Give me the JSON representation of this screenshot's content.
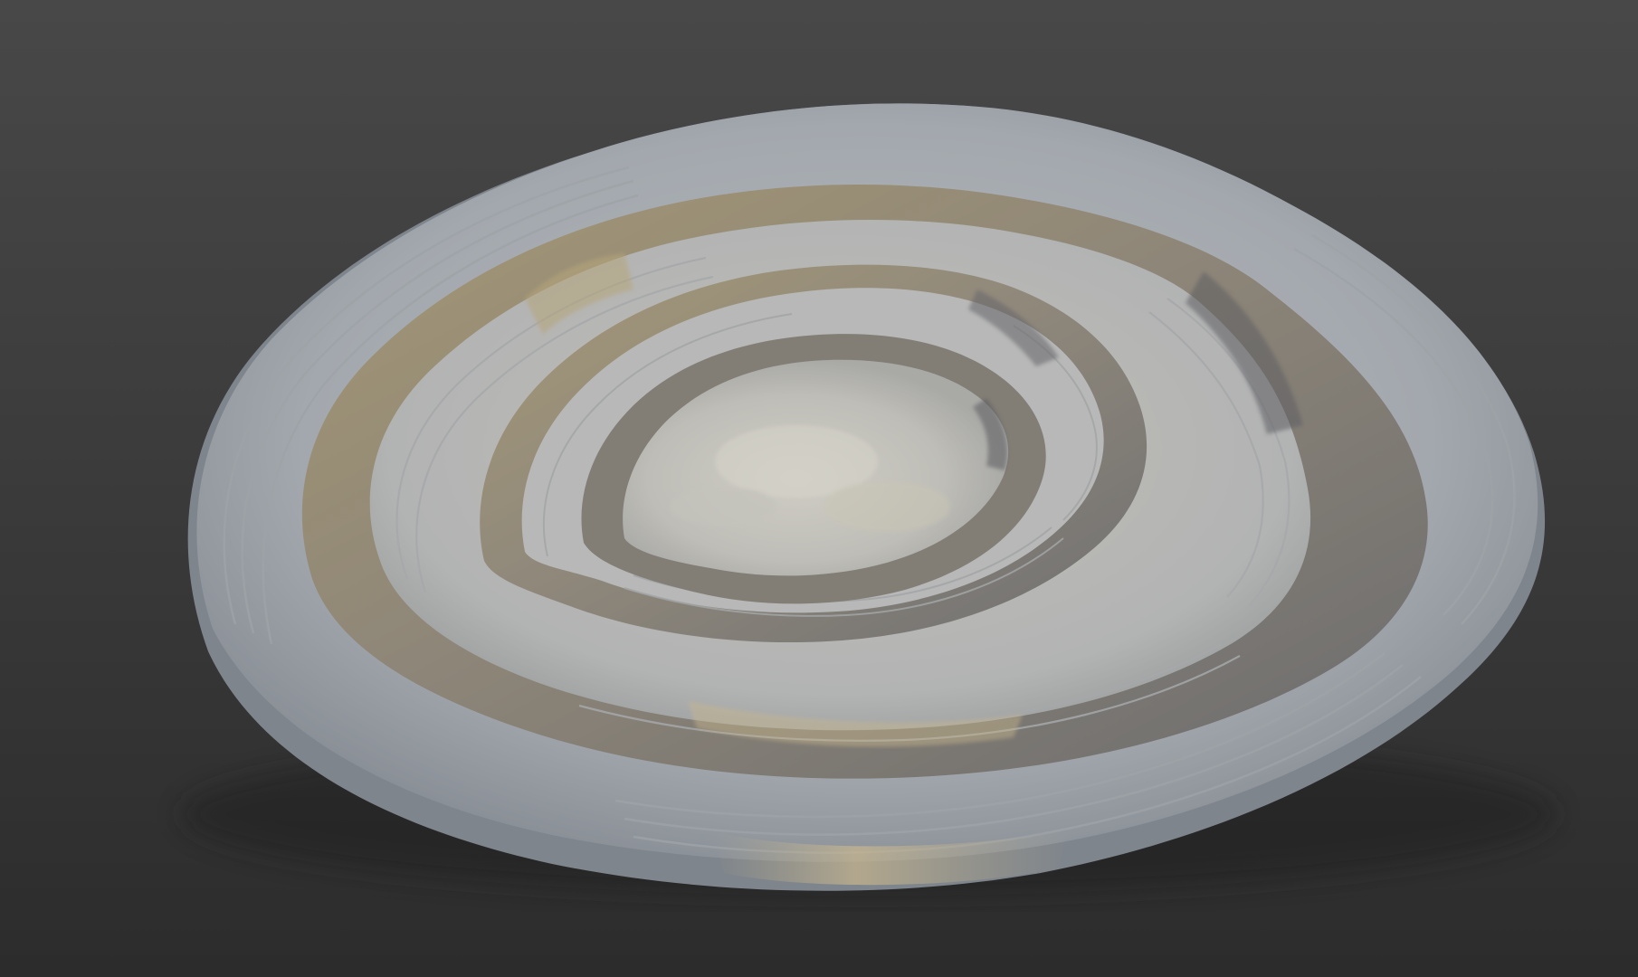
{
  "viewport": {
    "background_top": "#484848",
    "background_bottom": "#2c2c2c"
  },
  "model": {
    "subject": "open-pit-mine-terrain",
    "colors": {
      "rim": "#a9adb2",
      "rim_shadow": "#7d838a",
      "bench": "#b9bcc0",
      "wall_warm": "#a89c82",
      "wall_dark": "#6f6d6a",
      "floor": "#c3c2bd",
      "sand": "#c8b890"
    }
  }
}
